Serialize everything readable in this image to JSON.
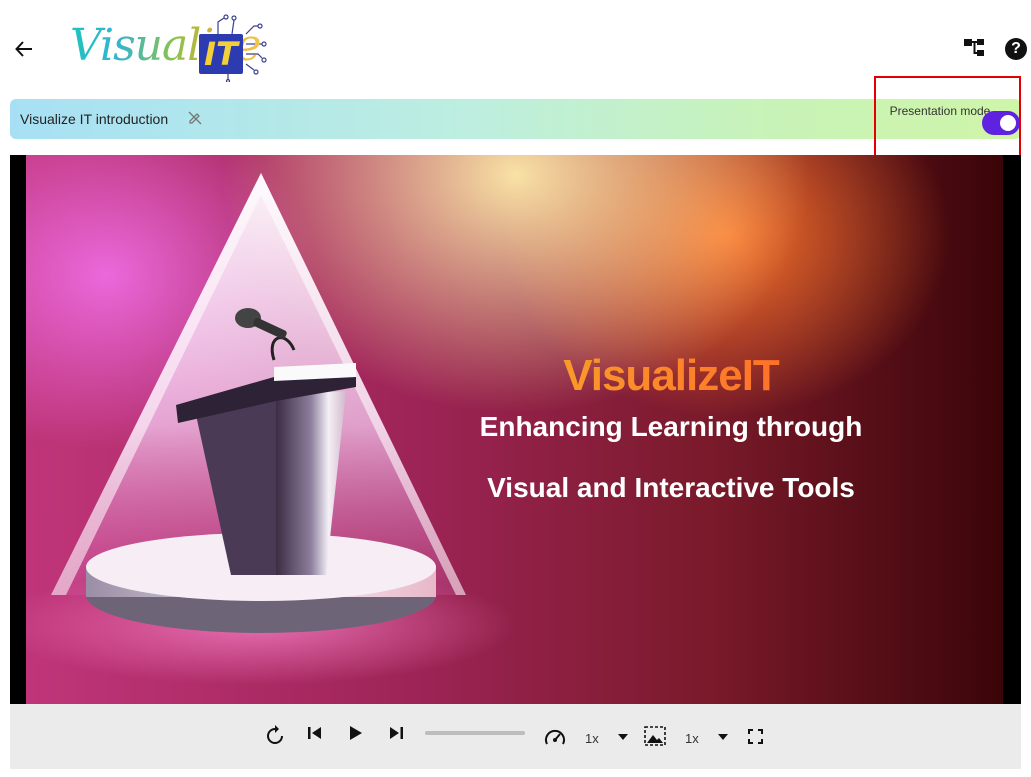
{
  "header": {
    "logo_text": "Visualize",
    "logo_badge": "IT",
    "back_icon": "arrow-left-icon",
    "tree_icon": "account-tree-icon",
    "help_label": "?"
  },
  "presentation": {
    "title": "Visualize IT introduction",
    "edit_icon": "edit-off-icon",
    "mode_label": "Presentation mode",
    "mode_enabled": true,
    "toggle_color": "#5f22e0",
    "highlight_color": "#e30000"
  },
  "slide": {
    "title": "VisualizeIT",
    "subtitle_line1": "Enhancing Learning through",
    "subtitle_line2": "Visual and Interactive Tools"
  },
  "controls": {
    "replay_icon": "replay-icon",
    "previous_icon": "skip-previous-icon",
    "play_icon": "play-icon",
    "next_icon": "skip-next-icon",
    "speed_icon": "speedometer-icon",
    "speed_value": "1x",
    "zoom_icon": "image-aspect-icon",
    "zoom_value": "1x",
    "fullscreen_icon": "fullscreen-icon"
  }
}
